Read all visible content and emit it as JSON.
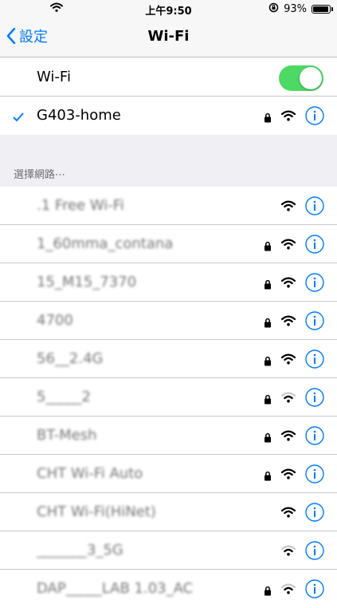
{
  "status_bar": {
    "time": "上午9:50",
    "battery_percent": "93%",
    "battery_level": 0.93
  },
  "nav": {
    "back_label": "設定",
    "title": "Wi-Fi"
  },
  "wifi_toggle": {
    "label": "Wi-Fi",
    "on": true
  },
  "connected_network": {
    "name": "G403-home",
    "secured": true,
    "signal": "full"
  },
  "section": {
    "choose_network_label": "選擇網路⋯"
  },
  "networks": [
    {
      "name": ".1 Free Wi-Fi",
      "secured": false,
      "signal": "full"
    },
    {
      "name": "1_60mma_contana",
      "secured": true,
      "signal": "full"
    },
    {
      "name": "15_M15_7370",
      "secured": true,
      "signal": "full"
    },
    {
      "name": "4700",
      "secured": true,
      "signal": "full"
    },
    {
      "name": "56__2.4G",
      "secured": true,
      "signal": "full"
    },
    {
      "name": "5_____2",
      "secured": true,
      "signal": "weak"
    },
    {
      "name": "BT-Mesh",
      "secured": true,
      "signal": "full"
    },
    {
      "name": "CHT Wi-Fi Auto",
      "secured": true,
      "signal": "full"
    },
    {
      "name": "CHT Wi-Fi(HiNet)",
      "secured": false,
      "signal": "full"
    },
    {
      "name": "_______3_5G",
      "secured": false,
      "signal": "weak"
    },
    {
      "name": "DAP_____LAB 1.03_AC",
      "secured": true,
      "signal": "weak"
    }
  ],
  "colors": {
    "accent": "#007aff",
    "toggle_on": "#4cd964",
    "background": "#efeff4",
    "separator": "#c8c7cc",
    "section_text": "#6d6d72"
  }
}
